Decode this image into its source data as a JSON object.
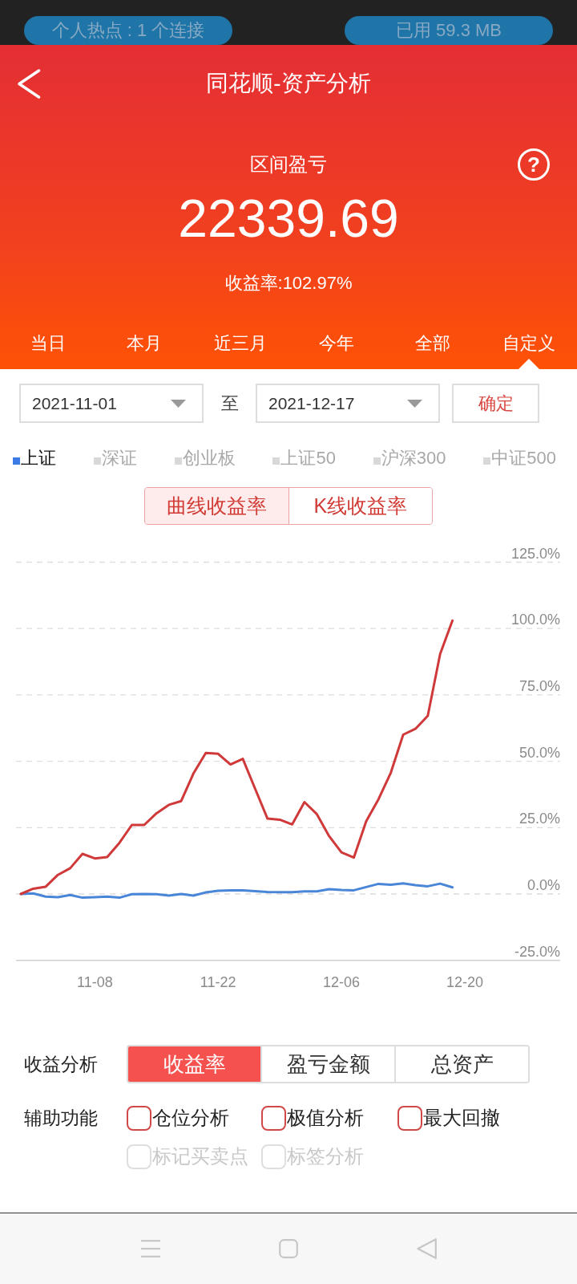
{
  "status_bar": {
    "hotspot": "个人热点 : 1 个连接",
    "data_usage": "已用 59.3 MB"
  },
  "header": {
    "title": "同花顺-资产分析",
    "summary_label": "区间盈亏",
    "help": "?",
    "amount": "22339.69",
    "return_rate": "收益率:102.97%"
  },
  "period_tabs": [
    {
      "label": "当日",
      "selected": false
    },
    {
      "label": "本月",
      "selected": false
    },
    {
      "label": "近三月",
      "selected": false
    },
    {
      "label": "今年",
      "selected": false
    },
    {
      "label": "全部",
      "selected": false
    },
    {
      "label": "自定义",
      "selected": true
    }
  ],
  "date_range": {
    "start": "2021-11-01",
    "separator": "至",
    "end": "2021-12-17",
    "confirm": "确定"
  },
  "index_tabs": [
    {
      "label": "上证",
      "selected": true
    },
    {
      "label": "深证",
      "selected": false
    },
    {
      "label": "创业板",
      "selected": false
    },
    {
      "label": "上证50",
      "selected": false
    },
    {
      "label": "沪深300",
      "selected": false
    },
    {
      "label": "中证500",
      "selected": false
    }
  ],
  "chart_modes": [
    {
      "label": "曲线收益率",
      "selected": true
    },
    {
      "label": "K线收益率",
      "selected": false
    }
  ],
  "chart": {
    "chart_data": {
      "type": "line",
      "grid": true,
      "categories": [
        null,
        null,
        null,
        null,
        null,
        null,
        "11-08",
        null,
        null,
        null,
        null,
        null,
        null,
        null,
        null,
        null,
        "11-22",
        null,
        null,
        null,
        null,
        null,
        null,
        null,
        null,
        null,
        "12-06",
        null,
        null,
        null,
        null,
        null,
        null,
        null,
        null,
        null,
        "12-20"
      ],
      "series": [
        {
          "color": "#d0393a",
          "values": [
            0,
            2.0,
            2.7,
            7.2,
            9.7,
            15.1,
            13.4,
            13.9,
            19.3,
            26.0,
            26.0,
            30.4,
            33.6,
            35.0,
            45.4,
            53.1,
            52.8,
            48.8,
            50.9,
            39.6,
            28.4,
            28.0,
            26.2,
            34.6,
            30.1,
            21.8,
            15.7,
            13.7,
            27.4,
            35.7,
            45.7,
            60.0,
            62.2,
            67.1,
            90.4,
            103.0,
            null
          ]
        },
        {
          "color": "#4a86d8",
          "values": [
            0,
            0.2,
            -1.0,
            -1.2,
            -0.4,
            -1.4,
            -1.2,
            -1.0,
            -1.4,
            -0.1,
            0,
            -0.1,
            -0.6,
            0,
            -0.6,
            0.6,
            1.2,
            1.4,
            1.4,
            1.1,
            0.8,
            0.7,
            0.7,
            1.0,
            1.0,
            1.8,
            1.5,
            1.4,
            2.6,
            3.8,
            3.5,
            4.0,
            3.3,
            2.9,
            3.9,
            2.5,
            null
          ]
        }
      ],
      "ylim": [
        -25,
        125
      ],
      "yticks": [
        {
          "value": 125,
          "label": "125.0%"
        },
        {
          "value": 100,
          "label": "100.0%"
        },
        {
          "value": 75,
          "label": "75.0%"
        },
        {
          "value": 50,
          "label": "50.0%"
        },
        {
          "value": 25,
          "label": "25.0%"
        },
        {
          "value": 0,
          "label": "0.0%"
        },
        {
          "value": -25,
          "label": "-25.0%"
        }
      ]
    }
  },
  "analysis": {
    "label": "收益分析",
    "options": [
      {
        "label": "收益率",
        "selected": true
      },
      {
        "label": "盈亏金额",
        "selected": false
      },
      {
        "label": "总资产",
        "selected": false
      }
    ]
  },
  "auxiliary": {
    "label": "辅助功能",
    "options": [
      {
        "label": "仓位分析",
        "checked": false,
        "disabled": false
      },
      {
        "label": "极值分析",
        "checked": false,
        "disabled": false
      },
      {
        "label": "最大回撤",
        "checked": false,
        "disabled": false
      },
      {
        "label": "标记买卖点",
        "checked": false,
        "disabled": true
      },
      {
        "label": "标签分析",
        "checked": false,
        "disabled": true
      }
    ]
  }
}
